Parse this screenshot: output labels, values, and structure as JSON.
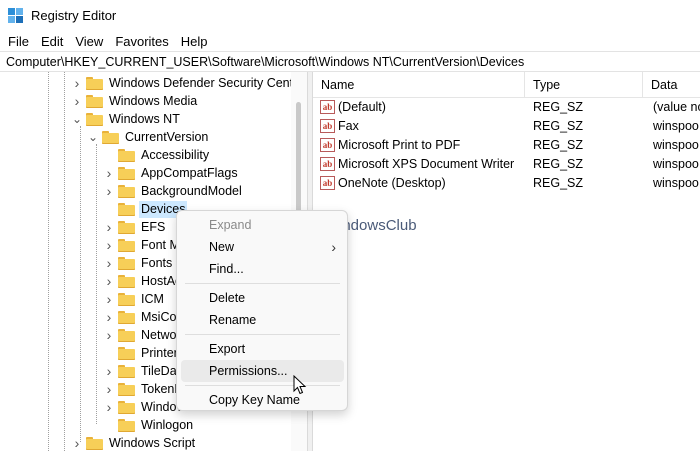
{
  "window": {
    "title": "Registry Editor"
  },
  "menu": [
    "File",
    "Edit",
    "View",
    "Favorites",
    "Help"
  ],
  "address": "Computer\\HKEY_CURRENT_USER\\Software\\Microsoft\\Windows NT\\CurrentVersion\\Devices",
  "tree": [
    {
      "label": "Windows Defender Security Center",
      "level": 0,
      "expander": "collapsed"
    },
    {
      "label": "Windows Media",
      "level": 0,
      "expander": "collapsed"
    },
    {
      "label": "Windows NT",
      "level": 0,
      "expander": "expanded"
    },
    {
      "label": "CurrentVersion",
      "level": 1,
      "expander": "expanded"
    },
    {
      "label": "Accessibility",
      "level": 2,
      "expander": "none"
    },
    {
      "label": "AppCompatFlags",
      "level": 2,
      "expander": "collapsed"
    },
    {
      "label": "BackgroundModel",
      "level": 2,
      "expander": "collapsed"
    },
    {
      "label": "Devices",
      "level": 2,
      "expander": "none",
      "selected": true
    },
    {
      "label": "EFS",
      "level": 2,
      "expander": "collapsed"
    },
    {
      "label": "Font M",
      "level": 2,
      "expander": "collapsed"
    },
    {
      "label": "Fonts",
      "level": 2,
      "expander": "collapsed"
    },
    {
      "label": "HostAc",
      "level": 2,
      "expander": "collapsed"
    },
    {
      "label": "ICM",
      "level": 2,
      "expander": "collapsed"
    },
    {
      "label": "MsiCor",
      "level": 2,
      "expander": "collapsed"
    },
    {
      "label": "Networ",
      "level": 2,
      "expander": "collapsed"
    },
    {
      "label": "PrinterI",
      "level": 2,
      "expander": "none"
    },
    {
      "label": "TileDat",
      "level": 2,
      "expander": "collapsed"
    },
    {
      "label": "TokenB",
      "level": 2,
      "expander": "collapsed"
    },
    {
      "label": "Windov",
      "level": 2,
      "expander": "collapsed"
    },
    {
      "label": "Winlogon",
      "level": 2,
      "expander": "none"
    },
    {
      "label": "Windows Script",
      "level": 0,
      "expander": "collapsed"
    }
  ],
  "list": {
    "columns": [
      "Name",
      "Type",
      "Data"
    ],
    "rows": [
      {
        "name": "(Default)",
        "type": "REG_SZ",
        "data": "(value no"
      },
      {
        "name": "Fax",
        "type": "REG_SZ",
        "data": "winspoo"
      },
      {
        "name": "Microsoft Print to PDF",
        "type": "REG_SZ",
        "data": "winspoo"
      },
      {
        "name": "Microsoft XPS Document Writer",
        "type": "REG_SZ",
        "data": "winspoo"
      },
      {
        "name": "OneNote (Desktop)",
        "type": "REG_SZ",
        "data": "winspoo"
      }
    ]
  },
  "context_menu": [
    {
      "label": "Expand",
      "disabled": true
    },
    {
      "label": "New",
      "submenu": true
    },
    {
      "label": "Find..."
    },
    {
      "separator": true
    },
    {
      "label": "Delete"
    },
    {
      "label": "Rename"
    },
    {
      "separator": true
    },
    {
      "label": "Export"
    },
    {
      "label": "Permissions...",
      "hover": true
    },
    {
      "separator": true
    },
    {
      "label": "Copy Key Name"
    }
  ],
  "watermark": "TheWindowsClub",
  "colors": {
    "selection": "#cce8ff",
    "folder": "#f7cf58",
    "accent": "#2d8fd8"
  }
}
